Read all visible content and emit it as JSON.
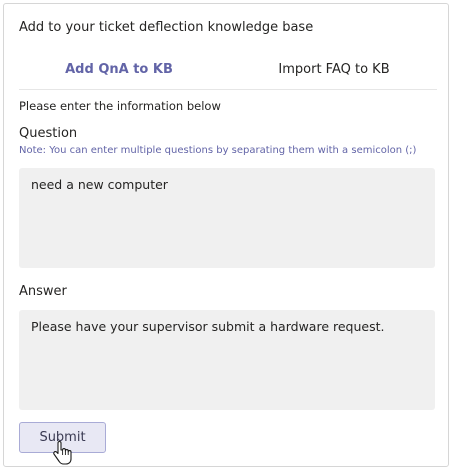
{
  "header": {
    "title": "Add to your ticket deflection knowledge base"
  },
  "tabs": [
    {
      "label": "Add QnA to KB",
      "active": true
    },
    {
      "label": "Import FAQ to KB",
      "active": false
    }
  ],
  "form": {
    "instructions": "Please enter the information below",
    "question_label": "Question",
    "question_note": "Note: You can enter multiple questions by separating them with a semicolon (;)",
    "question_value": "need a new computer",
    "answer_label": "Answer",
    "answer_value": "Please have your supervisor submit a hardware request.",
    "submit_label": "Submit"
  },
  "icons": {
    "cursor": "hand-pointer-icon"
  },
  "colors": {
    "accent": "#6264a7",
    "field_bg": "#f0f0f0"
  }
}
